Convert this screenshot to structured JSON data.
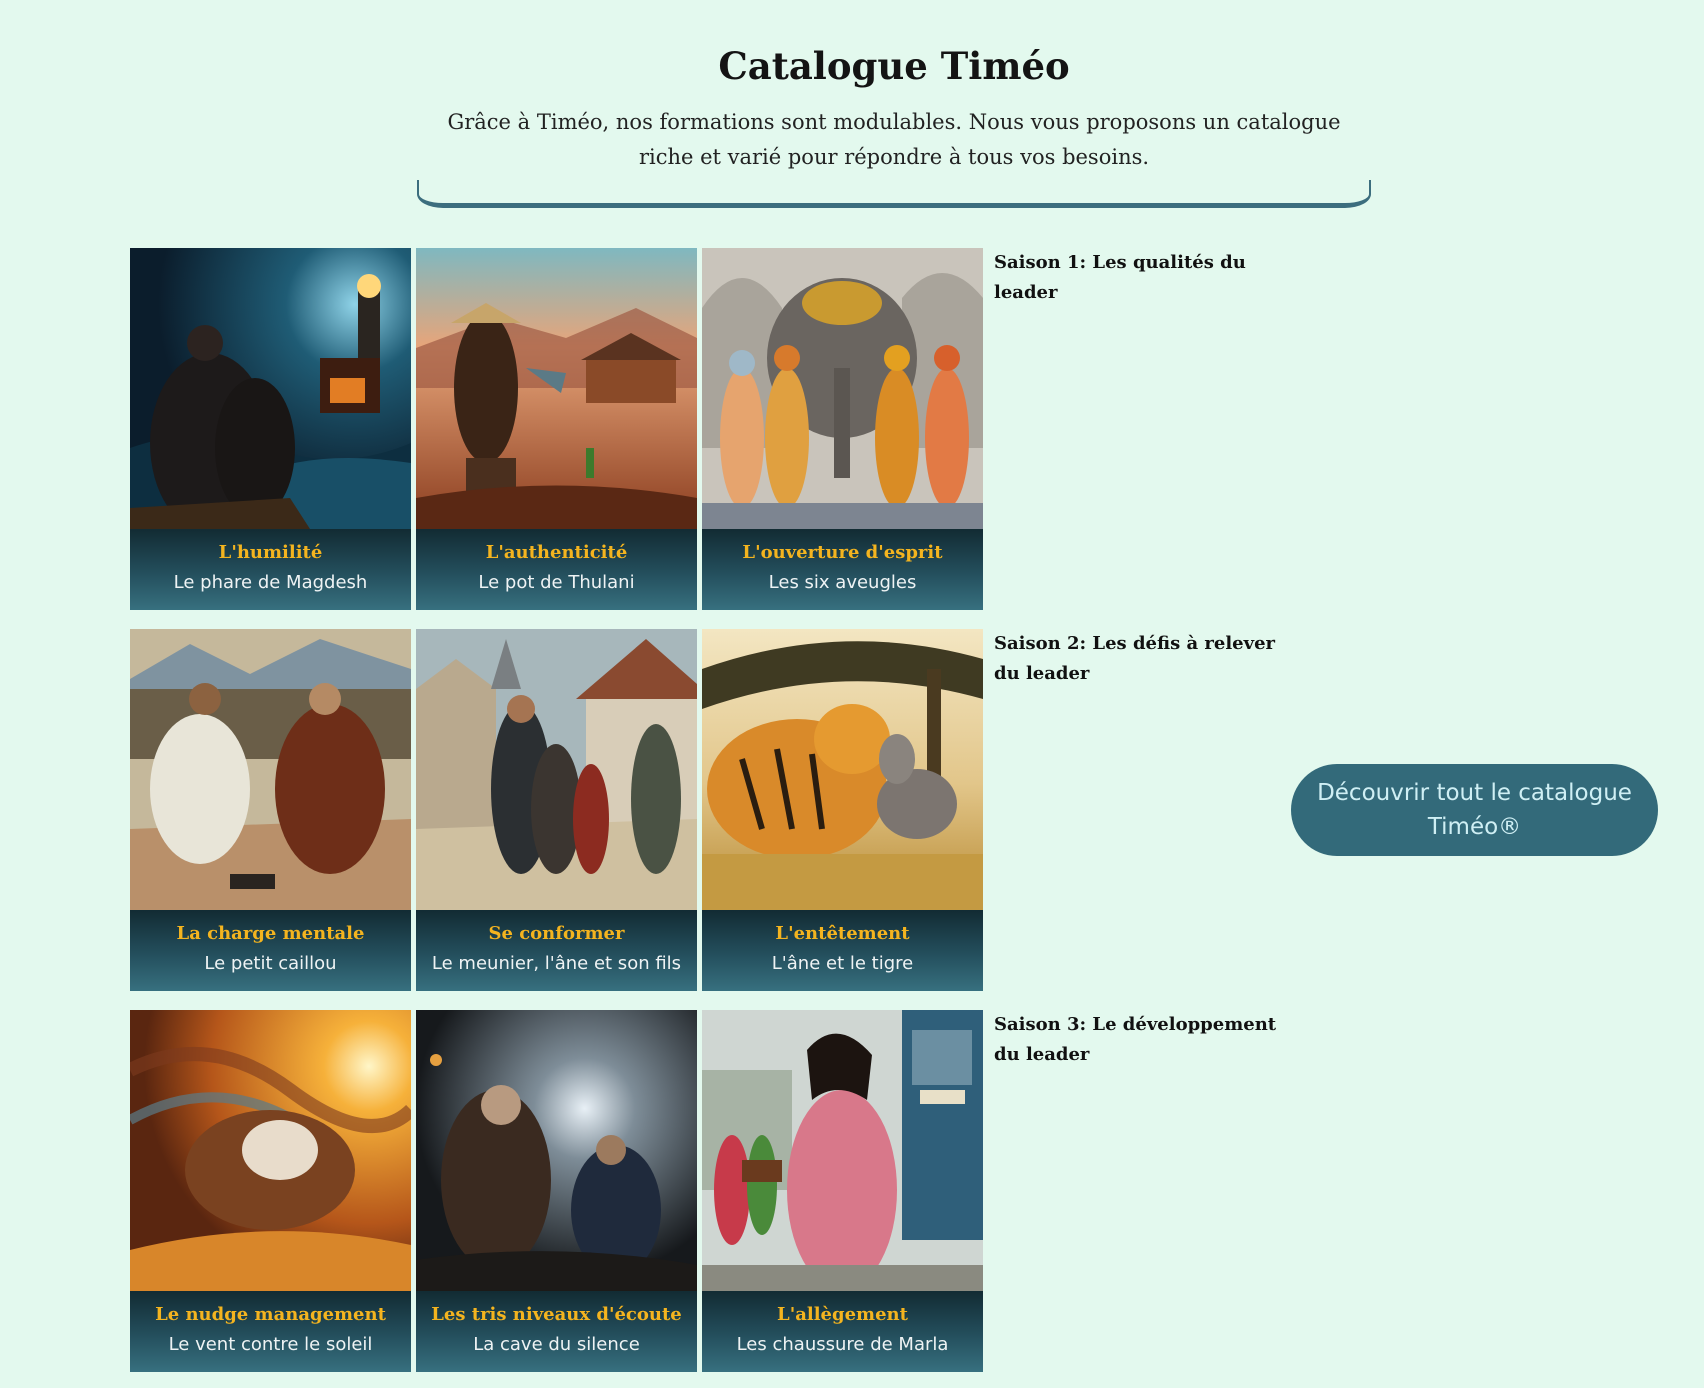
{
  "header": {
    "title": "Catalogue Timéo",
    "subtitle": "Grâce à Timéo, nos formations sont modulables. Nous vous proposons un catalogue riche et varié pour répondre à tous vos besoins."
  },
  "seasons": [
    {
      "label": "Saison 1: Les qualités du leader",
      "cards": [
        {
          "title": "L'humilité",
          "subtitle": "Le phare de Magdesh"
        },
        {
          "title": "L'authenticité",
          "subtitle": "Le pot de Thulani"
        },
        {
          "title": "L'ouverture d'esprit",
          "subtitle": "Les six aveugles"
        }
      ]
    },
    {
      "label": "Saison 2: Les défis à relever du leader",
      "cards": [
        {
          "title": "La charge mentale",
          "subtitle": "Le petit caillou"
        },
        {
          "title": "Se conformer",
          "subtitle": "Le meunier, l'âne et son fils"
        },
        {
          "title": "L'entêtement",
          "subtitle": "L'âne et le tigre"
        }
      ]
    },
    {
      "label": "Saison 3: Le développement du leader",
      "cards": [
        {
          "title": "Le nudge management",
          "subtitle": "Le vent contre le soleil"
        },
        {
          "title": "Les tris niveaux d'écoute",
          "subtitle": "La cave du silence"
        },
        {
          "title": "L'allègement",
          "subtitle": "Les chaussure de Marla"
        }
      ]
    }
  ],
  "cta": {
    "label": "Découvrir tout le catalogue Timéo®"
  },
  "colors": {
    "background": "#e3f9ee",
    "accent": "#336a7a",
    "card_title": "#f4b41f",
    "card_subtitle": "#eef3f4"
  }
}
